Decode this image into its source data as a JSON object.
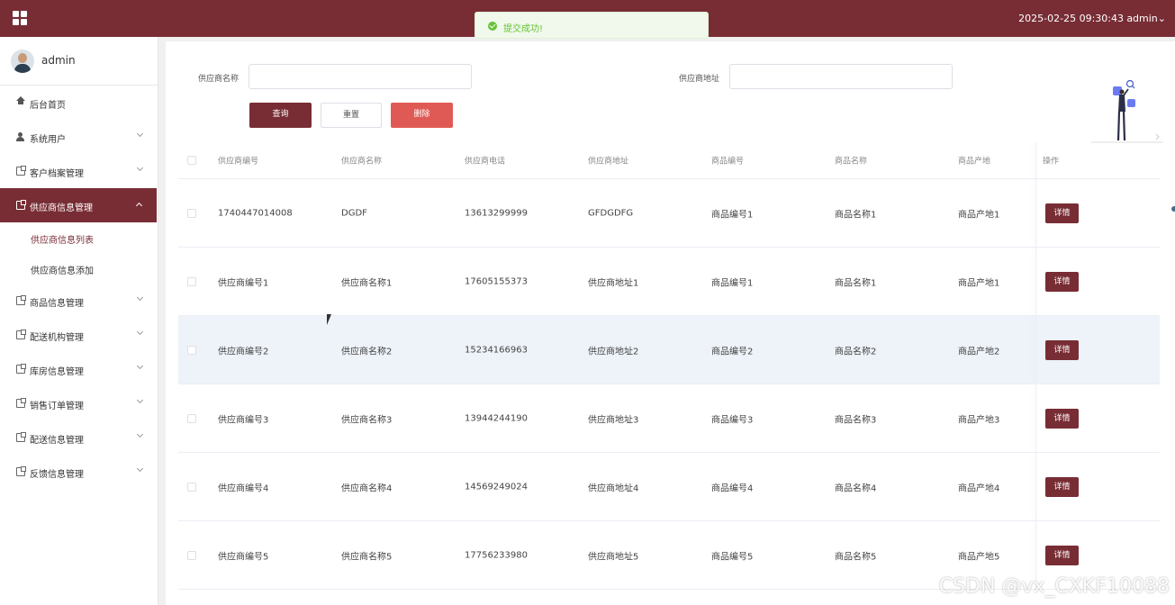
{
  "topbar": {
    "datetime": "2025-02-25 09:30:43",
    "user": "admin",
    "user_chevron": "⌄",
    "bg_color": "#782d35"
  },
  "toast": {
    "message": "提交成功!",
    "icon": "check-circle-icon"
  },
  "sidebar": {
    "profile_name": "admin",
    "items": [
      {
        "label": "后台首页",
        "icon": "home-icon"
      },
      {
        "label": "系统用户",
        "icon": "user-icon"
      },
      {
        "label": "客户档案管理",
        "icon": "doc-icon"
      },
      {
        "label": "供应商信息管理",
        "icon": "doc-icon",
        "active": true
      },
      {
        "label": "商品信息管理",
        "icon": "doc-icon"
      },
      {
        "label": "配送机构管理",
        "icon": "doc-icon"
      },
      {
        "label": "库房信息管理",
        "icon": "doc-icon"
      },
      {
        "label": "销售订单管理",
        "icon": "doc-icon"
      },
      {
        "label": "配送信息管理",
        "icon": "doc-icon"
      },
      {
        "label": "反馈信息管理",
        "icon": "doc-icon"
      }
    ],
    "sub_items": [
      {
        "label": "供应商信息列表",
        "current": true
      },
      {
        "label": "供应商信息添加"
      }
    ]
  },
  "search": {
    "name_label": "供应商名称",
    "name_value": "",
    "address_label": "供应商地址",
    "address_value": "",
    "query_button": "查询",
    "reset_button": "重置",
    "delete_button": "删除"
  },
  "table": {
    "headers": [
      "供应商编号",
      "供应商名称",
      "供应商电话",
      "供应商地址",
      "商品编号",
      "商品名称",
      "商品产地",
      "操作"
    ],
    "detail_label": "详情",
    "rows": [
      [
        "1740447014008",
        "DGDF",
        "13613299999",
        "GFDGDFG",
        "商品编号1",
        "商品名称1",
        "商品产地1"
      ],
      [
        "供应商编号1",
        "供应商名称1",
        "17605155373",
        "供应商地址1",
        "商品编号1",
        "商品名称1",
        "商品产地1"
      ],
      [
        "供应商编号2",
        "供应商名称2",
        "15234166963",
        "供应商地址2",
        "商品编号2",
        "商品名称2",
        "商品产地2"
      ],
      [
        "供应商编号3",
        "供应商名称3",
        "13944244190",
        "供应商地址3",
        "商品编号3",
        "商品名称3",
        "商品产地3"
      ],
      [
        "供应商编号4",
        "供应商名称4",
        "14569249024",
        "供应商地址4",
        "商品编号4",
        "商品名称4",
        "商品产地4"
      ],
      [
        "供应商编号5",
        "供应商名称5",
        "17756233980",
        "供应商地址5",
        "商品编号5",
        "商品名称5",
        "商品产地5"
      ]
    ]
  },
  "watermark": "CSDN @vx_CXKF10088"
}
